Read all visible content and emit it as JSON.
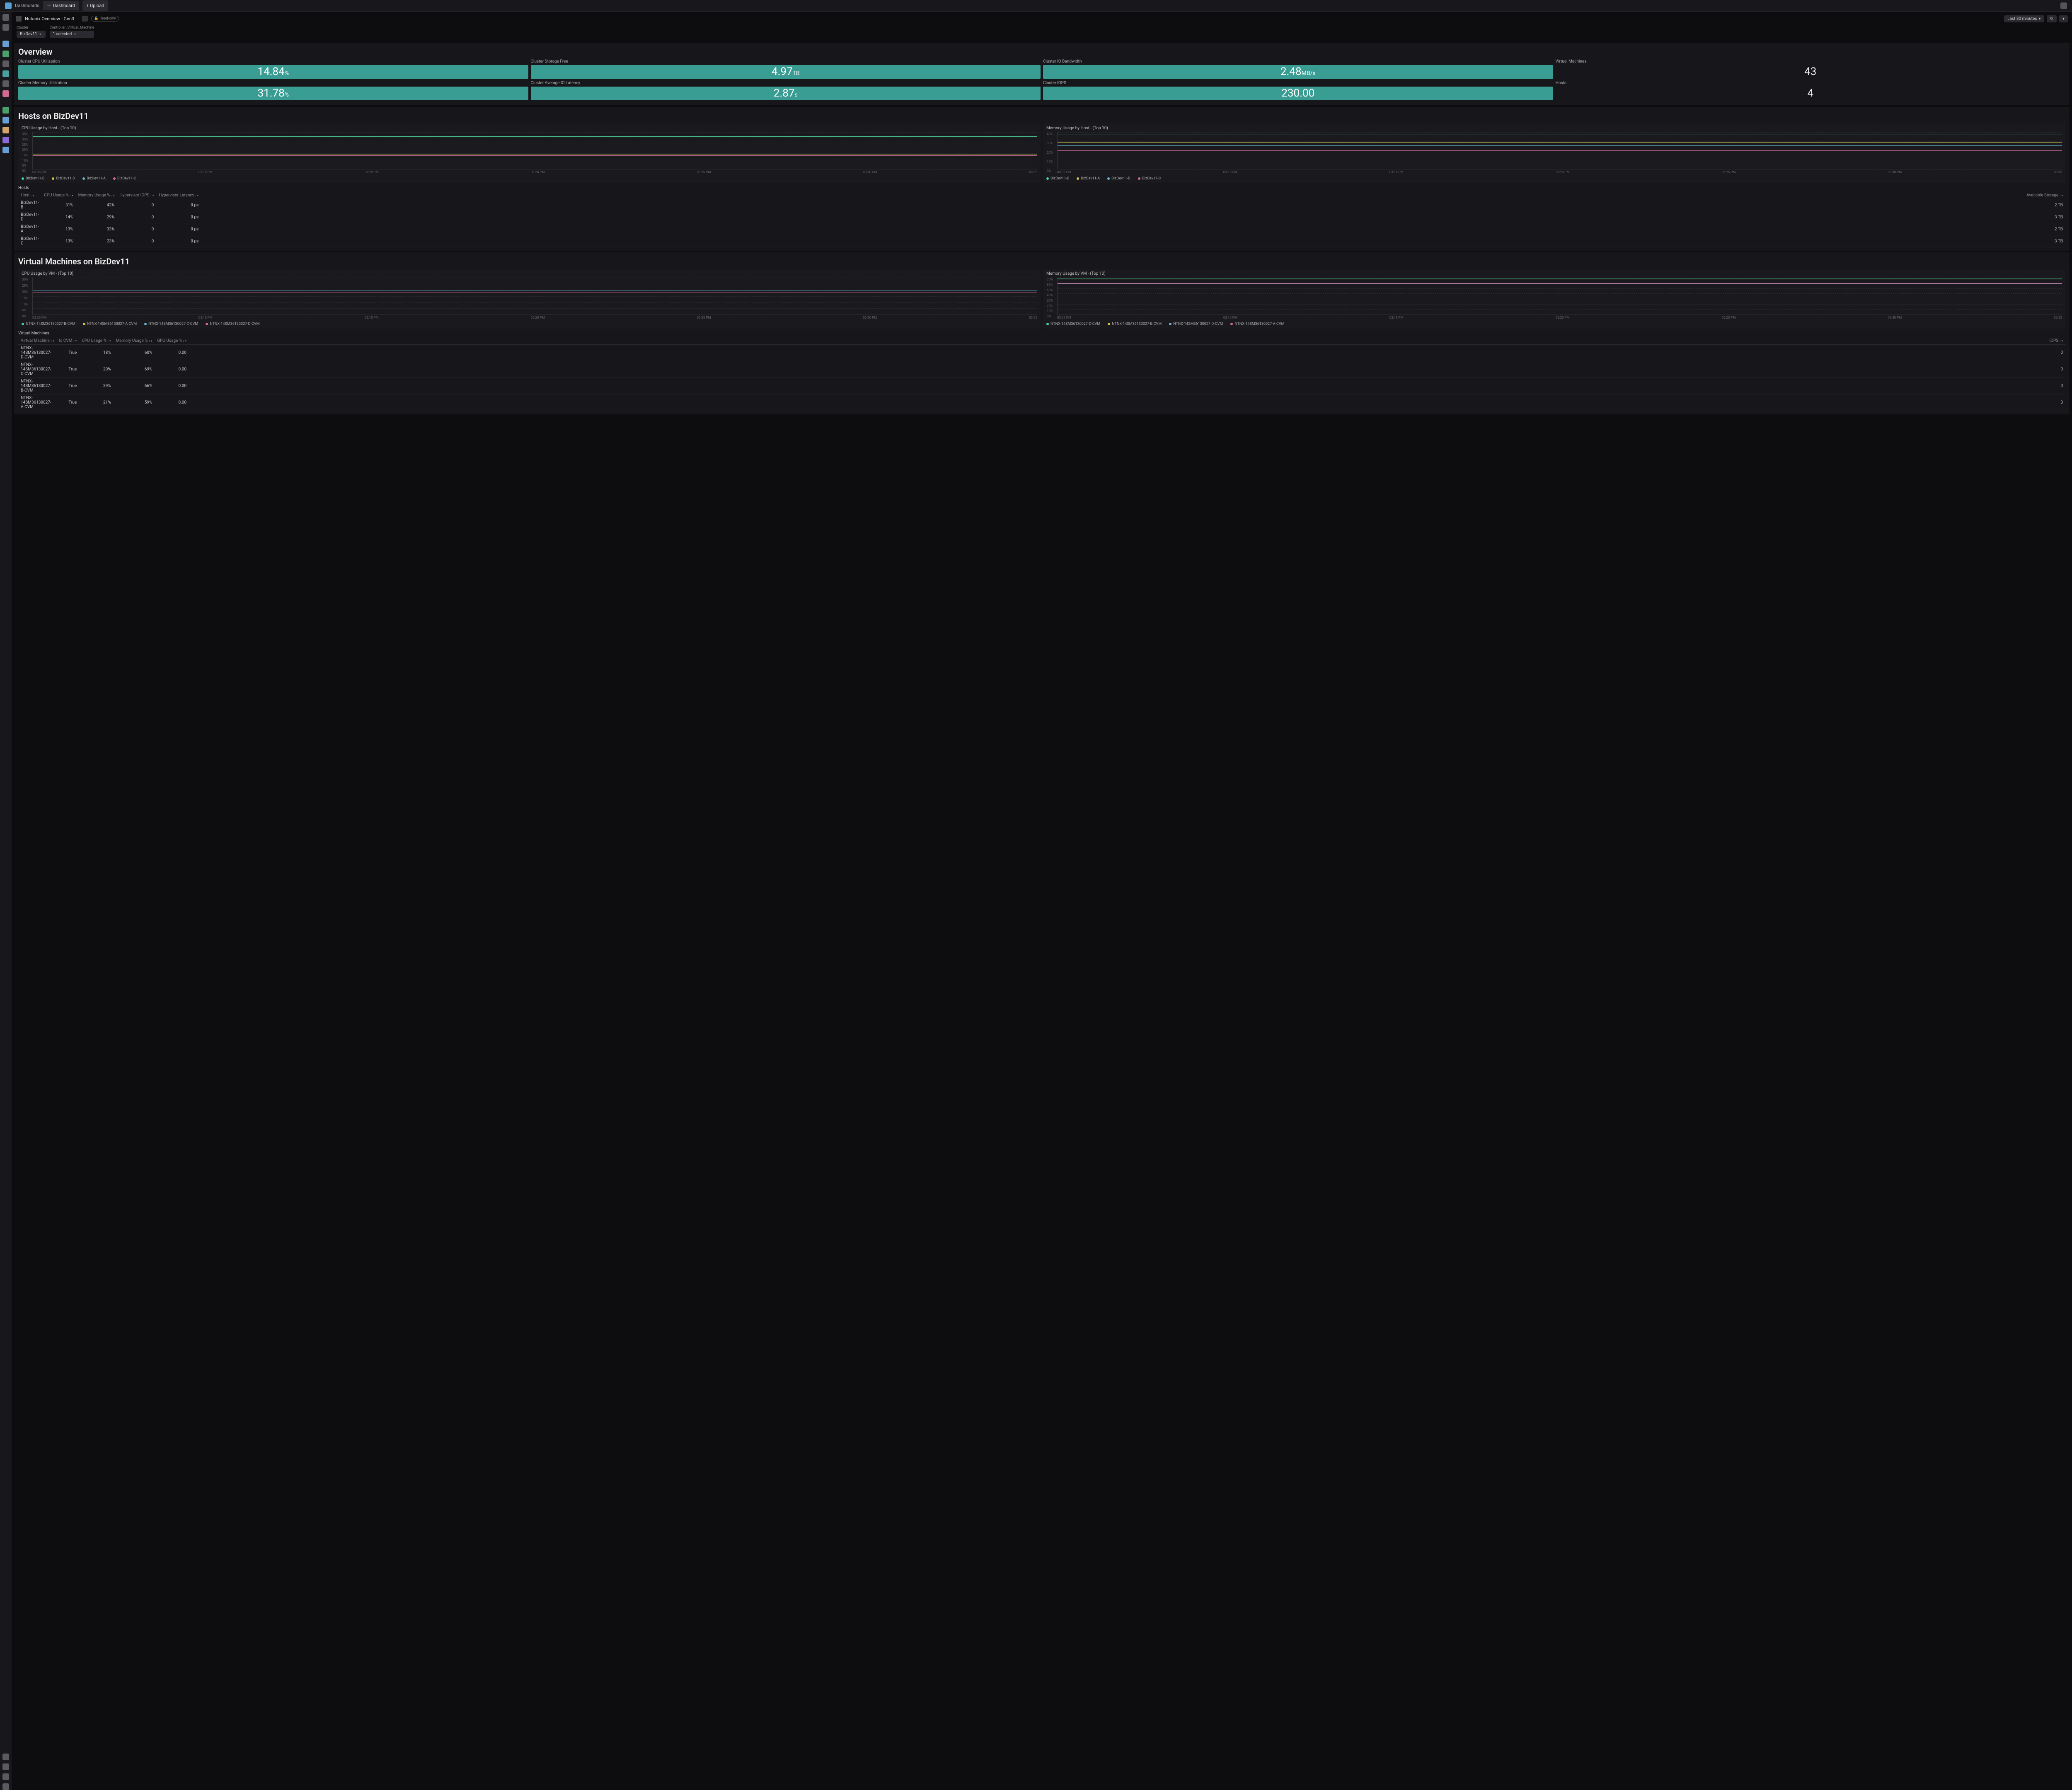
{
  "topbar": {
    "dashboards": "Dashboards",
    "add_dash": "Dashboard",
    "upload": "Upload"
  },
  "tab": {
    "name": "Nutanix Overview - Gen3",
    "readonly": "Read-only",
    "timerange": "Last 30 minutes"
  },
  "filters": {
    "cluster_label": "Cluster",
    "cluster_val": "BizDev11",
    "cvm_label": "Controller_Virtual_Machine",
    "cvm_val": "1 selected"
  },
  "overview": {
    "title": "Overview",
    "stats": [
      {
        "label": "Cluster CPU Utilization",
        "value": "14.84",
        "unit": "%"
      },
      {
        "label": "Cluster Storage Free",
        "value": "4.97",
        "unit": "TB"
      },
      {
        "label": "Cluster IO Bandwidth",
        "value": "2.48",
        "unit": "MB/s"
      },
      {
        "label": "Virtual Machines",
        "value": "43",
        "unit": "",
        "nocolor": true
      }
    ],
    "stats2": [
      {
        "label": "Cluster Memory Utilization",
        "value": "31.78",
        "unit": "%"
      },
      {
        "label": "Cluster Average IO Latency",
        "value": "2.87",
        "unit": "s"
      },
      {
        "label": "Cluster IOPS",
        "value": "230.00",
        "unit": ""
      },
      {
        "label": "Hosts",
        "value": "4",
        "unit": "",
        "nocolor": true
      }
    ]
  },
  "hosts_sec": {
    "title": "Hosts on BizDev11",
    "cpu_chart": {
      "title": "CPU Usage by Host - (Top 10)",
      "yticks": [
        "35%",
        "30%",
        "25%",
        "20%",
        "15%",
        "10%",
        "5%",
        "0%"
      ],
      "xticks": [
        "03:05 PM",
        "03:10 PM",
        "03:15 PM",
        "03:20 PM",
        "03:25 PM",
        "03:30 PM",
        "03:35"
      ],
      "series": [
        {
          "name": "BizDev11-B",
          "color": "#4ad49a",
          "y": 31
        },
        {
          "name": "BizDev11-D",
          "color": "#d4c44a",
          "y": 14
        },
        {
          "name": "BizDev11-A",
          "color": "#6ab4d4",
          "y": 13
        },
        {
          "name": "BizDev11-C",
          "color": "#d46a9a",
          "y": 13
        }
      ],
      "ymax": 35
    },
    "mem_chart": {
      "title": "Memory Usage by Host - (Top 10)",
      "yticks": [
        "40%",
        "30%",
        "20%",
        "10%",
        "0%"
      ],
      "xticks": [
        "03:05 PM",
        "03:10 PM",
        "03:15 PM",
        "03:20 PM",
        "03:25 PM",
        "03:30 PM",
        "03:35"
      ],
      "series": [
        {
          "name": "BizDev11-B",
          "color": "#4ad49a",
          "y": 42
        },
        {
          "name": "BizDev11-A",
          "color": "#d4c44a",
          "y": 33
        },
        {
          "name": "BizDev11-D",
          "color": "#6ab4d4",
          "y": 29
        },
        {
          "name": "BizDev11-C",
          "color": "#d46a9a",
          "y": 23
        }
      ],
      "ymax": 45
    },
    "table": {
      "title": "Hosts",
      "cols": [
        "Host",
        "CPU Usage %",
        "Memory Usage %",
        "Hypervisor IOPS",
        "Hypervisor Latency",
        "Available Storage"
      ],
      "rows": [
        [
          "BizDev11-B",
          "31%",
          "42%",
          "0",
          "0 µs",
          "2 TB"
        ],
        [
          "BizDev11-D",
          "14%",
          "29%",
          "0",
          "0 µs",
          "3 TB"
        ],
        [
          "BizDev11-A",
          "13%",
          "33%",
          "0",
          "0 µs",
          "2 TB"
        ],
        [
          "BizDev11-C",
          "13%",
          "23%",
          "0",
          "0 µs",
          "3 TB"
        ]
      ]
    }
  },
  "vms_sec": {
    "title": "Virtual Machines on BizDev11",
    "cpu_chart": {
      "title": "CPU Usage by VM - (Top 10)",
      "yticks": [
        "30%",
        "25%",
        "20%",
        "15%",
        "10%",
        "5%",
        "0%"
      ],
      "xticks": [
        "03:05 PM",
        "03:10 PM",
        "03:15 PM",
        "03:20 PM",
        "03:25 PM",
        "03:30 PM",
        "03:35"
      ],
      "series": [
        {
          "name": "NTNX-14SM36130027-B-CVM",
          "color": "#4ad49a",
          "y": 29
        },
        {
          "name": "NTNX-14SM36130027-A-CVM",
          "color": "#d4c44a",
          "y": 21
        },
        {
          "name": "NTNX-14SM36130027-C-CVM",
          "color": "#6ab4d4",
          "y": 20
        },
        {
          "name": "NTNX-14SM36130027-D-CVM",
          "color": "#d46a9a",
          "y": 18
        }
      ],
      "ymax": 30
    },
    "mem_chart": {
      "title": "Memory Usage by VM - (Top 10)",
      "yticks": [
        "70%",
        "60%",
        "50%",
        "40%",
        "30%",
        "20%",
        "10%",
        "0%"
      ],
      "xticks": [
        "03:05 PM",
        "03:10 PM",
        "03:15 PM",
        "03:20 PM",
        "03:25 PM",
        "03:30 PM",
        "03:35"
      ],
      "series": [
        {
          "name": "NTNX-14SM36130027-C-CVM",
          "color": "#4ad49a",
          "y": 69
        },
        {
          "name": "NTNX-14SM36130027-B-CVM",
          "color": "#d4c44a",
          "y": 66
        },
        {
          "name": "NTNX-14SM36130027-D-CVM",
          "color": "#6ab4d4",
          "y": 60
        },
        {
          "name": "NTNX-14SM36130027-A-CVM",
          "color": "#d46a9a",
          "y": 59
        }
      ],
      "ymax": 70
    },
    "table": {
      "title": "Virtual Machines",
      "cols": [
        "Virtual Machine",
        "Is CVM",
        "CPU Usage %",
        "Memory Usage %",
        "GPU Usage %",
        "IOPS"
      ],
      "rows": [
        [
          "NTNX-14SM36130027-D-CVM",
          "True",
          "18%",
          "60%",
          "0.00",
          "0"
        ],
        [
          "NTNX-14SM36130027-C-CVM",
          "True",
          "20%",
          "69%",
          "0.00",
          "0"
        ],
        [
          "NTNX-14SM36130027-B-CVM",
          "True",
          "29%",
          "66%",
          "0.00",
          "0"
        ],
        [
          "NTNX-14SM36130027-A-CVM",
          "True",
          "21%",
          "59%",
          "0.00",
          "0"
        ]
      ]
    }
  },
  "chart_data": [
    {
      "type": "line",
      "title": "CPU Usage by Host - (Top 10)",
      "ylabel": "%",
      "ylim": [
        0,
        35
      ],
      "x": [
        "03:05",
        "03:10",
        "03:15",
        "03:20",
        "03:25",
        "03:30",
        "03:35"
      ],
      "series": [
        {
          "name": "BizDev11-B",
          "values": [
            31,
            31,
            31,
            31,
            31,
            31,
            31
          ]
        },
        {
          "name": "BizDev11-D",
          "values": [
            14,
            14,
            14,
            14,
            14,
            14,
            14
          ]
        },
        {
          "name": "BizDev11-A",
          "values": [
            13,
            13,
            13,
            13,
            13,
            13,
            13
          ]
        },
        {
          "name": "BizDev11-C",
          "values": [
            13,
            13,
            13,
            13,
            13,
            13,
            13
          ]
        }
      ]
    },
    {
      "type": "line",
      "title": "Memory Usage by Host - (Top 10)",
      "ylabel": "%",
      "ylim": [
        0,
        45
      ],
      "x": [
        "03:05",
        "03:10",
        "03:15",
        "03:20",
        "03:25",
        "03:30",
        "03:35"
      ],
      "series": [
        {
          "name": "BizDev11-B",
          "values": [
            42,
            42,
            42,
            42,
            42,
            42,
            42
          ]
        },
        {
          "name": "BizDev11-A",
          "values": [
            33,
            33,
            33,
            33,
            33,
            33,
            33
          ]
        },
        {
          "name": "BizDev11-D",
          "values": [
            29,
            29,
            29,
            29,
            29,
            29,
            29
          ]
        },
        {
          "name": "BizDev11-C",
          "values": [
            23,
            23,
            23,
            23,
            23,
            23,
            23
          ]
        }
      ]
    },
    {
      "type": "line",
      "title": "CPU Usage by VM - (Top 10)",
      "ylabel": "%",
      "ylim": [
        0,
        30
      ],
      "x": [
        "03:05",
        "03:10",
        "03:15",
        "03:20",
        "03:25",
        "03:30",
        "03:35"
      ],
      "series": [
        {
          "name": "NTNX-14SM36130027-B-CVM",
          "values": [
            29,
            29,
            29,
            29,
            29,
            29,
            29
          ]
        },
        {
          "name": "NTNX-14SM36130027-A-CVM",
          "values": [
            21,
            21,
            21,
            21,
            21,
            21,
            21
          ]
        },
        {
          "name": "NTNX-14SM36130027-C-CVM",
          "values": [
            20,
            20,
            20,
            20,
            20,
            20,
            20
          ]
        },
        {
          "name": "NTNX-14SM36130027-D-CVM",
          "values": [
            18,
            18,
            18,
            18,
            18,
            18,
            18
          ]
        }
      ]
    },
    {
      "type": "line",
      "title": "Memory Usage by VM - (Top 10)",
      "ylabel": "%",
      "ylim": [
        0,
        70
      ],
      "x": [
        "03:05",
        "03:10",
        "03:15",
        "03:20",
        "03:25",
        "03:30",
        "03:35"
      ],
      "series": [
        {
          "name": "NTNX-14SM36130027-C-CVM",
          "values": [
            69,
            69,
            69,
            69,
            69,
            69,
            69
          ]
        },
        {
          "name": "NTNX-14SM36130027-B-CVM",
          "values": [
            66,
            66,
            66,
            66,
            66,
            66,
            66
          ]
        },
        {
          "name": "NTNX-14SM36130027-D-CVM",
          "values": [
            60,
            60,
            60,
            60,
            60,
            60,
            60
          ]
        },
        {
          "name": "NTNX-14SM36130027-A-CVM",
          "values": [
            59,
            59,
            59,
            59,
            59,
            59,
            59
          ]
        }
      ]
    }
  ]
}
